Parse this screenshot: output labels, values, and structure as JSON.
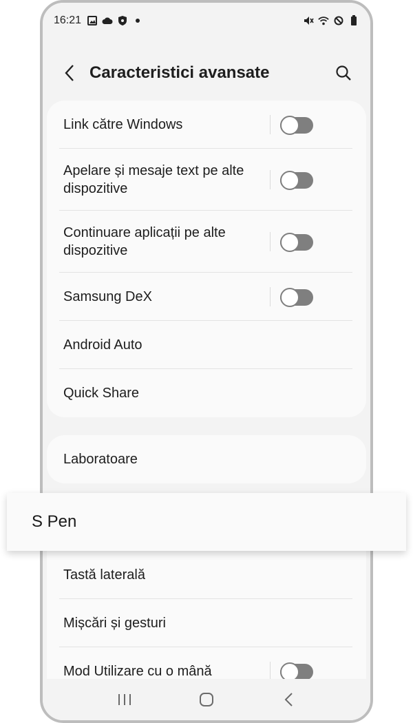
{
  "status_bar": {
    "time": "16:21",
    "left_icons": [
      "image-icon",
      "cloud-icon",
      "shield-icon",
      "dot-icon"
    ],
    "right_icons": [
      "mute-icon",
      "wifi-icon",
      "do-not-disturb-icon",
      "battery-icon"
    ]
  },
  "header": {
    "title": "Caracteristici avansate"
  },
  "group1": {
    "items": [
      {
        "label": "Link către Windows",
        "toggle": false
      },
      {
        "label": "Apelare și mesaje text pe alte dispozitive",
        "toggle": false
      },
      {
        "label": "Continuare aplicații pe alte dispozitive",
        "toggle": false
      },
      {
        "label": "Samsung DeX",
        "toggle": false
      },
      {
        "label": "Android Auto"
      },
      {
        "label": "Quick Share"
      }
    ]
  },
  "group2": {
    "items": [
      {
        "label": "Laboratoare"
      }
    ]
  },
  "highlight": {
    "label": "S Pen"
  },
  "group3": {
    "items": [
      {
        "label": "Tastă laterală"
      },
      {
        "label": "Mișcări și gesturi"
      },
      {
        "label": "Mod Utilizare cu o mână",
        "toggle": false
      }
    ]
  },
  "colors": {
    "background": "#f3f3f3",
    "card": "#fafafa",
    "toggle_off": "#7f7f7f",
    "text": "#1d1d1d"
  }
}
